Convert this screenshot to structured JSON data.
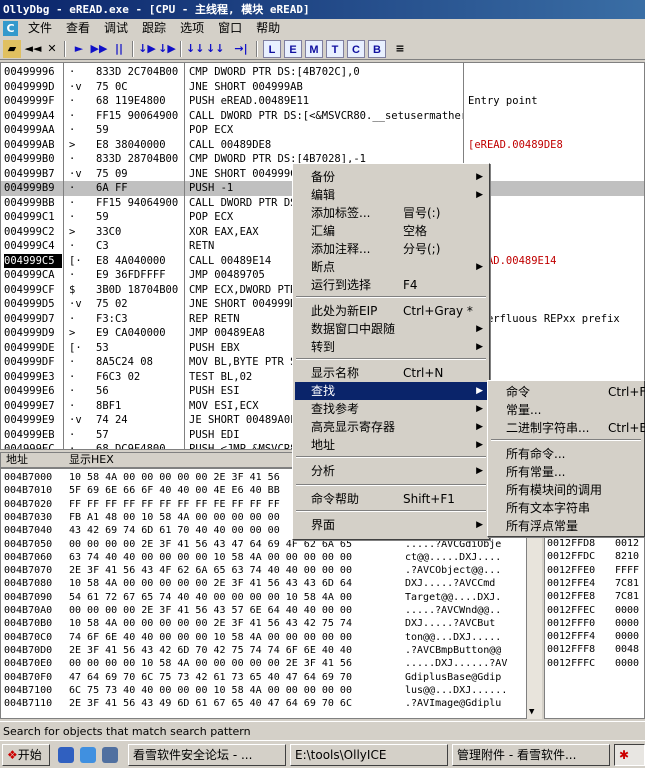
{
  "window": {
    "title": "OllyDbg - eREAD.exe - [CPU - 主线程, 模块 eREAD]"
  },
  "menubar": {
    "items": [
      "文件",
      "查看",
      "调试",
      "跟踪",
      "选项",
      "窗口",
      "帮助"
    ],
    "app_icon": "C"
  },
  "toolbar": {
    "glyphs": [
      "◄◄",
      "✕",
      "►",
      "▶▶",
      "||",
      "↓▶",
      "↓▶",
      "↓↓",
      "↓↓",
      "→|"
    ],
    "letters": [
      "L",
      "E",
      "M",
      "T",
      "C",
      "B"
    ],
    "list_icon": "≡"
  },
  "disasm": {
    "rows": [
      {
        "addr": "00499996",
        "arr": "·",
        "hex": "833D 2C704B00",
        "ins": "CMP DWORD PTR DS:[4B702C],0",
        "cmt": ""
      },
      {
        "addr": "0049999D",
        "arr": "·v",
        "hex": "75 0C",
        "ins": "JNE SHORT 004999AB",
        "cmt": ""
      },
      {
        "addr": "0049999F",
        "arr": "·",
        "hex": "68 119E4800",
        "ins": "PUSH eREAD.00489E11",
        "cmt": "Entry point"
      },
      {
        "addr": "004999A4",
        "arr": "·",
        "hex": "FF15 90064900",
        "ins": "CALL DWORD PTR DS:[<&MSVCR80.__setusermatherr>]",
        "cmt": ""
      },
      {
        "addr": "004999AA",
        "arr": "·",
        "hex": "59",
        "ins": "POP ECX",
        "cmt": ""
      },
      {
        "addr": "004999AB",
        "arr": ">",
        "hex": "E8 38040000",
        "ins": "CALL 00489DE8",
        "cmt": "[eREAD.00489DE8"
      },
      {
        "addr": "004999B0",
        "arr": "·",
        "hex": "833D 28704B00",
        "ins": "CMP DWORD PTR DS:[4B7028],-1",
        "cmt": ""
      },
      {
        "addr": "004999B7",
        "arr": "·v",
        "hex": "75 09",
        "ins": "JNE SHORT 004999C2",
        "cmt": ""
      },
      {
        "addr": "004999B9",
        "arr": "·",
        "hex": "6A FF",
        "ins": "PUSH -1",
        "cmt": ""
      },
      {
        "addr": "004999BB",
        "arr": "·",
        "hex": "FF15 94064900",
        "ins": "CALL DWORD PTR DS:[<&MSVCR80._cexit>]",
        "cmt": ""
      },
      {
        "addr": "004999C1",
        "arr": "·",
        "hex": "59",
        "ins": "POP ECX",
        "cmt": ""
      },
      {
        "addr": "004999C2",
        "arr": ">",
        "hex": "33C0",
        "ins": "XOR EAX,EAX",
        "cmt": ""
      },
      {
        "addr": "004999C4",
        "arr": "·",
        "hex": "C3",
        "ins": "RETN",
        "cmt": ""
      },
      {
        "addr": "004999C5",
        "arr": "[·",
        "hex": "E8 4A040000",
        "ins": "CALL 00489E14",
        "cmt": "eREAD.00489E14"
      },
      {
        "addr": "004999CA",
        "arr": "·",
        "hex": "E9 36FDFFFF",
        "ins": "JMP 00489705",
        "cmt": ""
      },
      {
        "addr": "004999CF",
        "arr": "$",
        "hex": "3B0D 18704B00",
        "ins": "CMP ECX,DWORD PTR DS:[4B7018]",
        "cmt": ""
      },
      {
        "addr": "004999D5",
        "arr": "·v",
        "hex": "75 02",
        "ins": "JNE SHORT 004999D9",
        "cmt": ""
      },
      {
        "addr": "004999D7",
        "arr": "·",
        "hex": "F3:C3",
        "ins": "REP RETN",
        "cmt": "Superfluous REPxx prefix"
      },
      {
        "addr": "004999D9",
        "arr": ">",
        "hex": "E9 CA040000",
        "ins": "JMP 00489EA8",
        "cmt": ""
      },
      {
        "addr": "004999DE",
        "arr": "[·",
        "hex": "53",
        "ins": "PUSH EBX",
        "cmt": ""
      },
      {
        "addr": "004999DF",
        "arr": "·",
        "hex": "8A5C24 08",
        "ins": "MOV BL,BYTE PTR SS:[ESP+8]",
        "cmt": ""
      },
      {
        "addr": "004999E3",
        "arr": "·",
        "hex": "F6C3 02",
        "ins": "TEST BL,02",
        "cmt": ""
      },
      {
        "addr": "004999E6",
        "arr": "·",
        "hex": "56",
        "ins": "PUSH ESI",
        "cmt": ""
      },
      {
        "addr": "004999E7",
        "arr": "·",
        "hex": "8BF1",
        "ins": "MOV ESI,ECX",
        "cmt": ""
      },
      {
        "addr": "004999E9",
        "arr": "·v",
        "hex": "74 24",
        "ins": "JE SHORT 00489A0F",
        "cmt": ""
      },
      {
        "addr": "004999EB",
        "arr": "·",
        "hex": "57",
        "ins": "PUSH EDI",
        "cmt": ""
      },
      {
        "addr": "004999EC",
        "arr": "·",
        "hex": "68 DC9F4800",
        "ins": "PUSH <JMP.&MSVCR80.??1type_info@@UAE@XZ>",
        "cmt": ""
      }
    ]
  },
  "dump": {
    "header_addr": "地址",
    "header_hex": "显示HEX",
    "rows": [
      {
        "addr": "004B7000",
        "hx": "10 58 4A 00 00 00 00 00 2E 3F 41 56",
        "as": ""
      },
      {
        "addr": "004B7010",
        "hx": "5F 69 6E 66 6F 40 40 00 4E E6 40 BB",
        "as": ""
      },
      {
        "addr": "004B7020",
        "hx": "FF FF FF FF FF FF FF FF FE FF FF FF",
        "as": ""
      },
      {
        "addr": "004B7030",
        "hx": "FB A1 48 00 10 58 4A 00 00 00 00 00",
        "as": ""
      },
      {
        "addr": "004B7040",
        "hx": "43 42 69 74 6D 61 70 40 40 00 00 00",
        "as": ""
      },
      {
        "addr": "004B7050",
        "hx": "00 00 00 00 2E 3F 41 56 43 47 64 69 4F 62 6A 65",
        "as": ".....?AVCGdiObje"
      },
      {
        "addr": "004B7060",
        "hx": "63 74 40 40 00 00 00 00 10 58 4A 00 00 00 00 00",
        "as": "ct@@.....DXJ...."
      },
      {
        "addr": "004B7070",
        "hx": "2E 3F 41 56 43 4F 62 6A 65 63 74 40 40 00 00 00",
        "as": ".?AVCObject@@..."
      },
      {
        "addr": "004B7080",
        "hx": "10 58 4A 00 00 00 00 00 2E 3F 41 56 43 43 6D 64",
        "as": "DXJ.....?AVCCmd"
      },
      {
        "addr": "004B7090",
        "hx": "54 61 72 67 65 74 40 40 00 00 00 00 10 58 4A 00",
        "as": "Target@@....DXJ."
      },
      {
        "addr": "004B70A0",
        "hx": "00 00 00 00 2E 3F 41 56 43 57 6E 64 40 40 00 00",
        "as": ".....?AVCWnd@@.."
      },
      {
        "addr": "004B70B0",
        "hx": "10 58 4A 00 00 00 00 00 2E 3F 41 56 43 42 75 74",
        "as": "DXJ.....?AVCBut"
      },
      {
        "addr": "004B70C0",
        "hx": "74 6F 6E 40 40 00 00 00 10 58 4A 00 00 00 00 00",
        "as": "ton@@...DXJ....."
      },
      {
        "addr": "004B70D0",
        "hx": "2E 3F 41 56 43 42 6D 70 42 75 74 74 6F 6E 40 40",
        "as": ".?AVCBmpButton@@"
      },
      {
        "addr": "004B70E0",
        "hx": "00 00 00 00 10 58 4A 00 00 00 00 00 2E 3F 41 56",
        "as": ".....DXJ......?AV"
      },
      {
        "addr": "004B70F0",
        "hx": "47 64 69 70 6C 75 73 42 61 73 65 40 47 64 69 70",
        "as": "GdiplusBase@Gdip"
      },
      {
        "addr": "004B7100",
        "hx": "6C 75 73 40 40 00 00 00 10 58 4A 00 00 00 00 00",
        "as": "lus@@...DXJ......"
      },
      {
        "addr": "004B7110",
        "hx": "2E 3F 41 56 43 49 6D 61 67 65 40 47 64 69 70 6C",
        "as": ".?AVImage@Gdiplu"
      }
    ]
  },
  "stack": {
    "rows": [
      {
        "a1": "0012FFD8",
        "a2": "0012"
      },
      {
        "a1": "0012FFDC",
        "a2": "8210"
      },
      {
        "a1": "0012FFE0",
        "a2": "FFFF"
      },
      {
        "a1": "0012FFE4",
        "a2": "7C81"
      },
      {
        "a1": "0012FFE8",
        "a2": "7C81"
      },
      {
        "a1": "0012FFEC",
        "a2": "0000"
      },
      {
        "a1": "0012FFF0",
        "a2": "0000"
      },
      {
        "a1": "0012FFF4",
        "a2": "0000"
      },
      {
        "a1": "0012FFF8",
        "a2": "0048"
      },
      {
        "a1": "0012FFFC",
        "a2": "0000"
      }
    ]
  },
  "context_menu": {
    "items": [
      {
        "label": "备份",
        "key": "",
        "sub": true
      },
      {
        "label": "编辑",
        "key": "",
        "sub": true
      },
      {
        "label": "添加标签...",
        "key": "冒号(:)",
        "sub": false
      },
      {
        "label": "汇编",
        "key": "空格",
        "sub": false
      },
      {
        "label": "添加注释...",
        "key": "分号(;)",
        "sub": false
      },
      {
        "label": "断点",
        "key": "",
        "sub": true
      },
      {
        "label": "运行到选择",
        "key": "F4",
        "sub": false
      },
      {
        "label": "此处为新EIP",
        "key": "Ctrl+Gray *",
        "sub": false
      },
      {
        "label": "数据窗口中跟随",
        "key": "",
        "sub": true
      },
      {
        "label": "转到",
        "key": "",
        "sub": true
      },
      {
        "label": "显示名称",
        "key": "Ctrl+N",
        "sub": false
      },
      {
        "label": "查找",
        "key": "",
        "sub": true
      },
      {
        "label": "查找参考",
        "key": "",
        "sub": true
      },
      {
        "label": "高亮显示寄存器",
        "key": "",
        "sub": true
      },
      {
        "label": "地址",
        "key": "",
        "sub": true
      },
      {
        "label": "分析",
        "key": "",
        "sub": true
      },
      {
        "label": "命令帮助",
        "key": "Shift+F1",
        "sub": false
      },
      {
        "label": "界面",
        "key": "",
        "sub": true
      }
    ]
  },
  "submenu": {
    "items": [
      {
        "label": "命令",
        "key": "Ctrl+F"
      },
      {
        "label": "常量...",
        "key": ""
      },
      {
        "label": "二进制字符串...",
        "key": "Ctrl+B"
      },
      {
        "label": "所有命令...",
        "key": ""
      },
      {
        "label": "所有常量...",
        "key": ""
      },
      {
        "label": "所有模块间的调用",
        "key": ""
      },
      {
        "label": "所有文本字符串",
        "key": ""
      },
      {
        "label": "所有浮点常量",
        "key": ""
      }
    ]
  },
  "status": {
    "text": "Search for objects that match search pattern"
  },
  "taskbar": {
    "start": "开始",
    "tasks": [
      "看雪软件安全论坛 - ...",
      "E:\\tools\\OllyICE",
      "管理附件 - 看雪软件..."
    ]
  }
}
